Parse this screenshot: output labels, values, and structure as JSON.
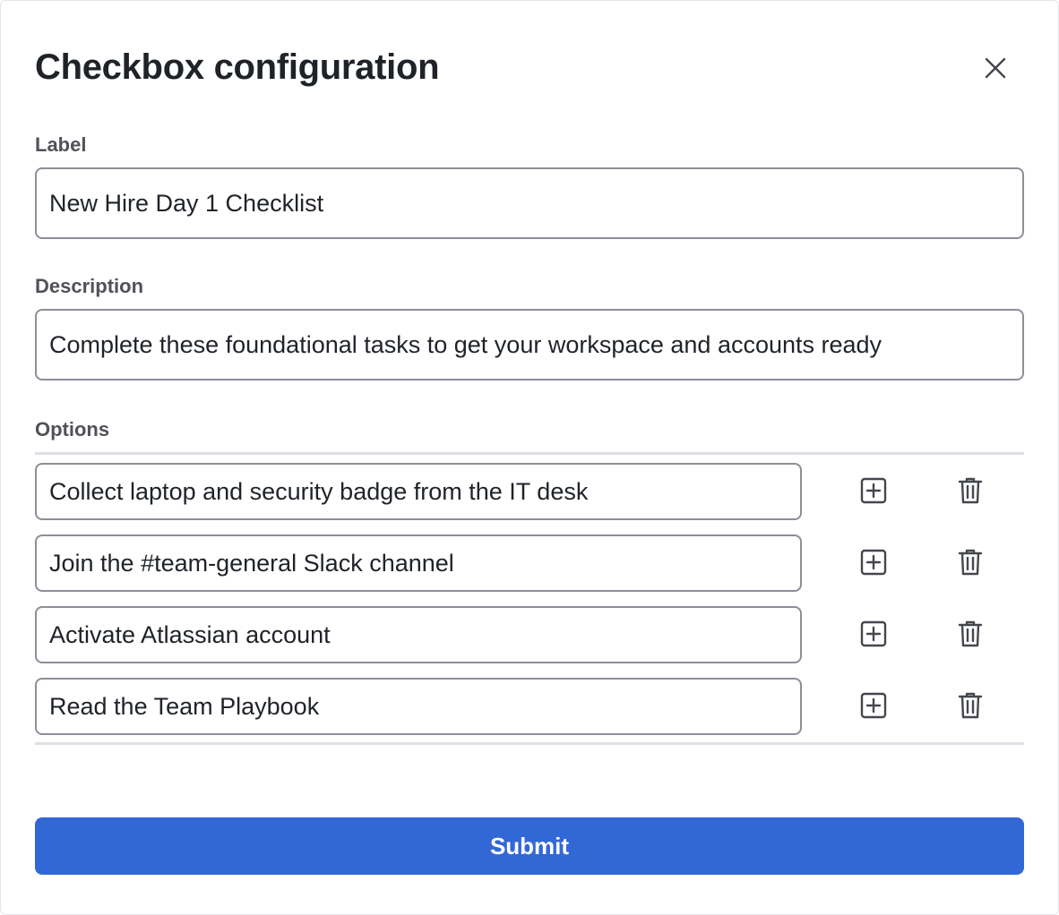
{
  "dialog": {
    "title": "Checkbox configuration",
    "close_icon": "close-icon"
  },
  "label_field": {
    "label": "Label",
    "value": "New Hire Day 1 Checklist"
  },
  "description_field": {
    "label": "Description",
    "value": "Complete these foundational tasks to get your workspace and accounts ready"
  },
  "options": {
    "label": "Options",
    "add_icon": "plus-square-icon",
    "delete_icon": "trash-icon",
    "items": [
      {
        "value": "Collect laptop and security badge from the IT desk"
      },
      {
        "value": "Join the #team-general Slack channel"
      },
      {
        "value": "Activate Atlassian account"
      },
      {
        "value": "Read the Team Playbook"
      }
    ]
  },
  "footer": {
    "submit_label": "Submit"
  },
  "colors": {
    "accent": "#3267d6",
    "border": "#8c8f97",
    "label_text": "#505258",
    "divider": "#dcdfe4"
  }
}
